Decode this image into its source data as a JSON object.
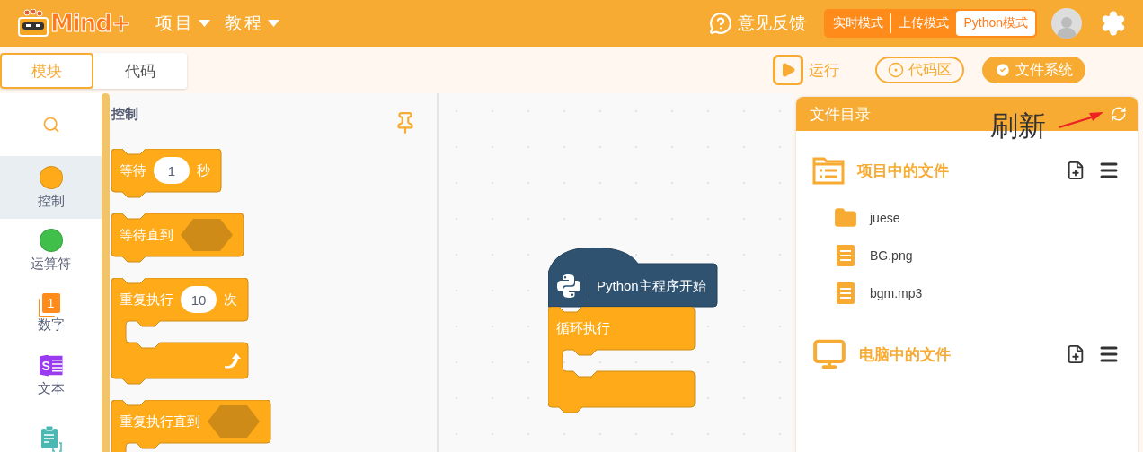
{
  "header": {
    "logo": "Mind+",
    "menus": [
      {
        "label": "项目"
      },
      {
        "label": "教程"
      }
    ],
    "feedback": "意见反馈",
    "modes": [
      {
        "label": "实时模式",
        "selected": false
      },
      {
        "label": "上传模式",
        "selected": false
      },
      {
        "label": "Python模式",
        "selected": true
      }
    ]
  },
  "tabs": [
    {
      "label": "模块",
      "selected": true
    },
    {
      "label": "代码",
      "selected": false
    }
  ],
  "toolbar": {
    "run": "运行",
    "toggles": [
      {
        "label": "代码区",
        "on": false
      },
      {
        "label": "文件系统",
        "on": true
      }
    ]
  },
  "categories": [
    {
      "kind": "dot",
      "label": "控制",
      "color": "#ffab19",
      "selected": true
    },
    {
      "kind": "dot",
      "label": "运算符",
      "color": "#40bf4a",
      "selected": false
    },
    {
      "kind": "number",
      "badge": "1",
      "label": "数字",
      "color": "#ff8c1a",
      "selected": false
    },
    {
      "kind": "text",
      "badge": "S",
      "label": "文本",
      "color": "#9a3bf0",
      "selected": false
    },
    {
      "kind": "list",
      "color": "#4cb8b4",
      "selected": false
    }
  ],
  "palette": {
    "title": "控制",
    "blocks": [
      {
        "kind": "stack",
        "parts": [
          {
            "kind": "label",
            "text": "等待"
          },
          {
            "kind": "number",
            "text": "1"
          },
          {
            "kind": "label",
            "text": "秒"
          }
        ]
      },
      {
        "kind": "stack",
        "parts": [
          {
            "kind": "label",
            "text": "等待直到"
          },
          {
            "kind": "condition"
          }
        ]
      },
      {
        "kind": "loop",
        "arrow": true,
        "parts": [
          {
            "kind": "label",
            "text": "重复执行"
          },
          {
            "kind": "number",
            "text": "10"
          },
          {
            "kind": "label",
            "text": "次"
          }
        ]
      },
      {
        "kind": "loop",
        "parts": [
          {
            "kind": "label",
            "text": "重复执行直到"
          },
          {
            "kind": "condition"
          }
        ]
      }
    ]
  },
  "canvas": {
    "hat": "Python主程序开始",
    "loop": "循环执行"
  },
  "files": {
    "title": "文件目录",
    "annotation": "刷新",
    "sections": [
      {
        "kind": "project",
        "title": "项目中的文件",
        "files": [
          {
            "kind": "folder",
            "name": "juese"
          },
          {
            "kind": "file",
            "name": "BG.png"
          },
          {
            "kind": "file",
            "name": "bgm.mp3"
          }
        ]
      },
      {
        "kind": "computer",
        "title": "电脑中的文件"
      }
    ]
  }
}
